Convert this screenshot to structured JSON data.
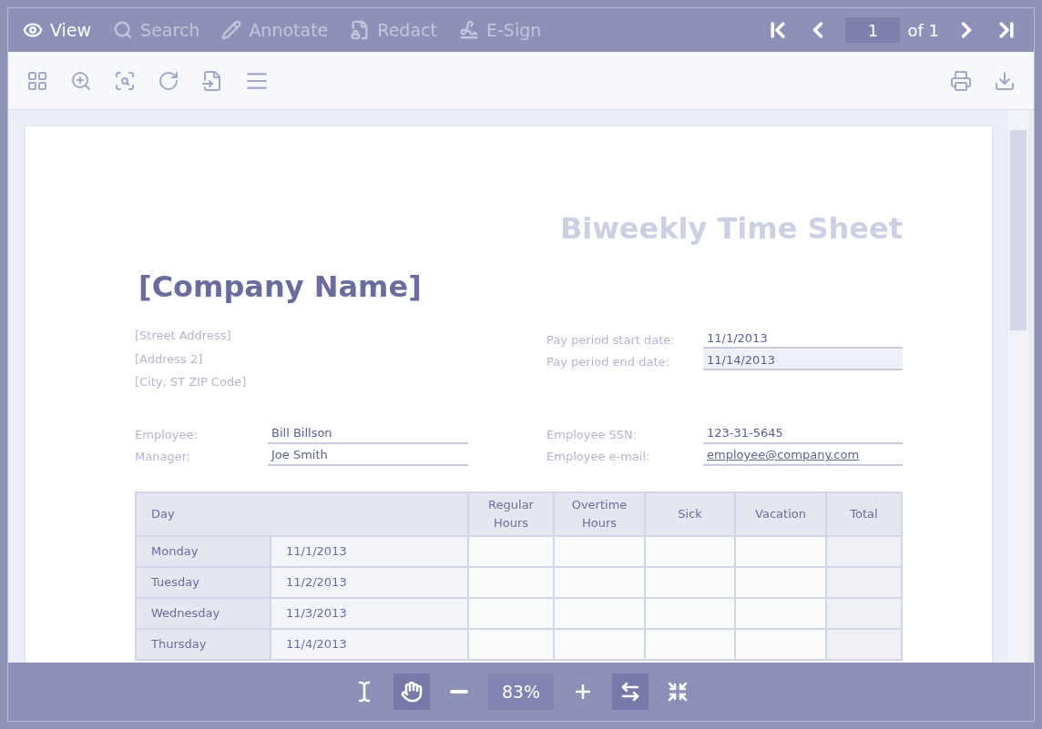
{
  "tabs": [
    {
      "label": "View",
      "selected": true
    },
    {
      "label": "Search",
      "selected": false
    },
    {
      "label": "Annotate",
      "selected": false
    },
    {
      "label": "Redact",
      "selected": false
    },
    {
      "label": "E-Sign",
      "selected": false
    }
  ],
  "pager": {
    "page": "1",
    "of": "of 1"
  },
  "document": {
    "title": "Biweekly Time Sheet",
    "company": "[Company Name]",
    "address": [
      "[Street Address]",
      "[Address 2]",
      "[City, ST  ZIP Code]"
    ],
    "period": [
      {
        "label": "Pay period start date:",
        "value": "11/1/2013",
        "shaded": false
      },
      {
        "label": "Pay period end date:",
        "value": "11/14/2013",
        "shaded": true
      }
    ],
    "people": [
      {
        "label": "Employee:",
        "value": "Bill Billson"
      },
      {
        "label": "Manager:",
        "value": "Joe Smith"
      }
    ],
    "contact": [
      {
        "label": "Employee SSN:",
        "value": "123-31-5645",
        "kind": "text"
      },
      {
        "label": "Employee e-mail:",
        "value": "employee@company.com",
        "kind": "link"
      }
    ],
    "table": {
      "columns": [
        "Day",
        "Regular Hours",
        "Overtime Hours",
        "Sick",
        "Vacation",
        "Total"
      ],
      "rows": [
        {
          "day": "Monday",
          "date": "11/1/2013"
        },
        {
          "day": "Tuesday",
          "date": "11/2/2013"
        },
        {
          "day": "Wednesday",
          "date": "11/3/2013"
        },
        {
          "day": "Thursday",
          "date": "11/4/2013"
        }
      ]
    }
  },
  "zoom": {
    "tools": [
      {
        "kind": "text-select",
        "selected": false
      },
      {
        "kind": "hand",
        "selected": true
      },
      {
        "kind": "zoom-out",
        "selected": false
      }
    ],
    "value": "83%",
    "tools_after": [
      {
        "kind": "zoom-in",
        "selected": false
      },
      {
        "kind": "fit-width",
        "selected": true
      },
      {
        "kind": "fullscreen",
        "selected": false
      }
    ]
  }
}
